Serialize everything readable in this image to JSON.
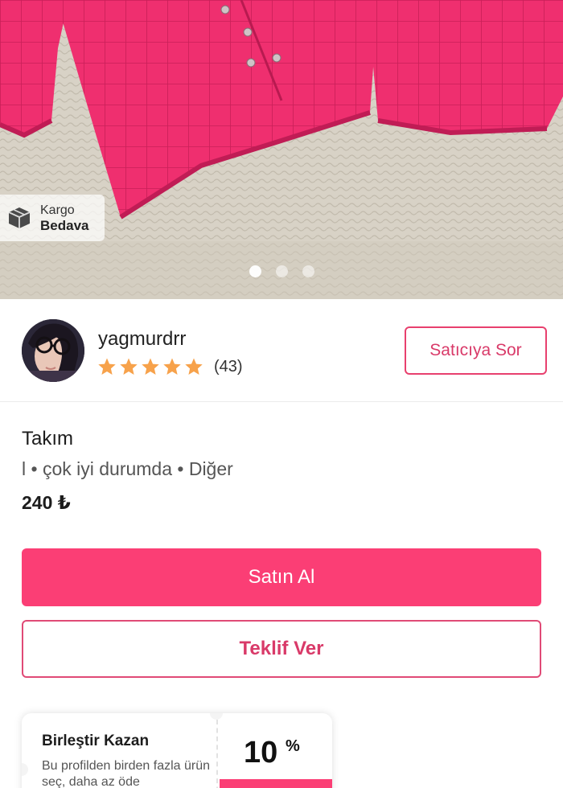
{
  "hero": {
    "badge": {
      "icon": "package-box-icon",
      "line1": "Kargo",
      "line2": "Bedava"
    },
    "carousel": {
      "count": 3,
      "active_index": 0
    }
  },
  "seller": {
    "username": "yagmurdrr",
    "rating_stars": 5,
    "review_count": "(43)",
    "ask_button_label": "Satıcıya Sor"
  },
  "product": {
    "title": "Takım",
    "meta": "l • çok iyi durumda • Diğer",
    "price": "240 ₺"
  },
  "actions": {
    "buy_label": "Satın Al",
    "offer_label": "Teklif Ver"
  },
  "promo": {
    "title": "Birleştir Kazan",
    "description": "Bu profilden birden fazla ürün seç, daha az öde",
    "percent": "10",
    "percent_sign": "%"
  },
  "colors": {
    "accent": "#fb3e75",
    "accent_text": "#d93a69",
    "star": "#f7a24b"
  }
}
